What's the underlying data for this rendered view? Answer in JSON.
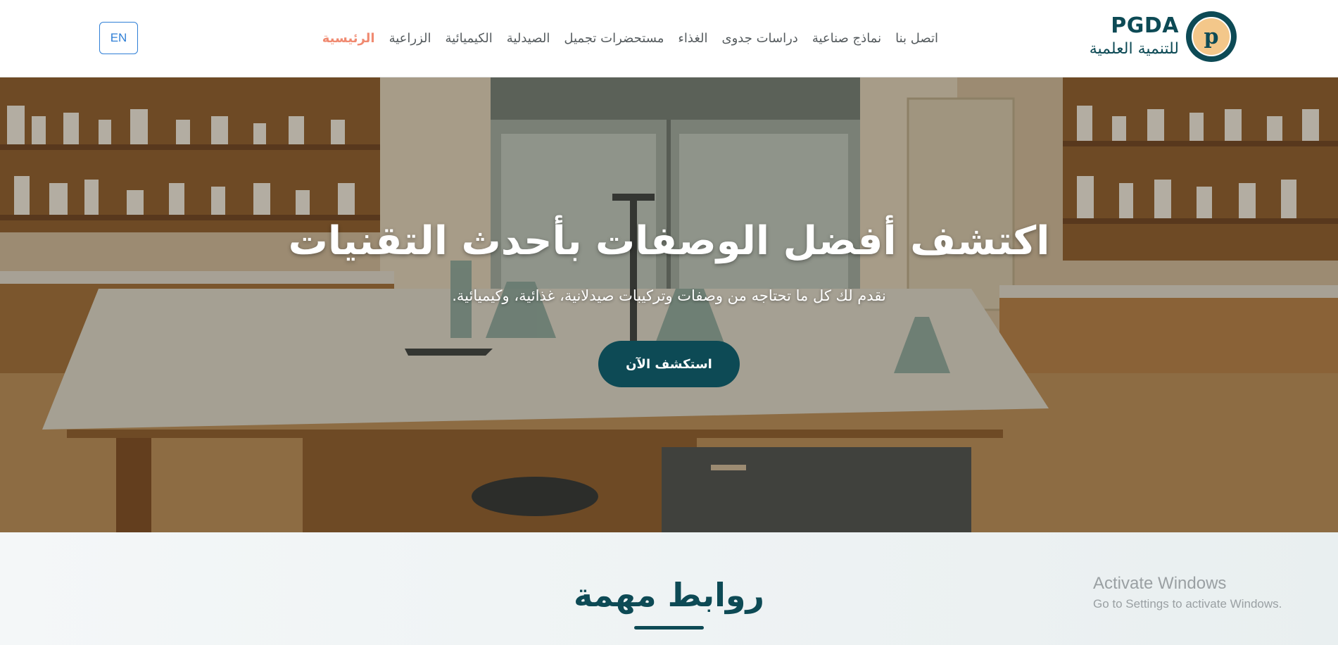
{
  "header": {
    "brand_name": "PGDA",
    "brand_subtitle": "للتنمية العلمية",
    "logo_letter": "p",
    "language_button": "EN",
    "nav": [
      {
        "label": "الرئيسية",
        "active": true
      },
      {
        "label": "الزراعية"
      },
      {
        "label": "الكيميائية"
      },
      {
        "label": "الصيدلية"
      },
      {
        "label": "مستحضرات تجميل"
      },
      {
        "label": "الغذاء"
      },
      {
        "label": "دراسات جدوى"
      },
      {
        "label": "نماذج صناعية"
      },
      {
        "label": "اتصل بنا"
      }
    ]
  },
  "hero": {
    "title": "اكتشف أفضل الوصفات بأحدث التقنيات",
    "subtitle": "نقدم لك كل ما تحتاجه من وصفات وتركيبات صيدلانية، غذائية، وكيميائية.",
    "cta_label": "استكشف الآن"
  },
  "links_section": {
    "title": "روابط مهمة"
  },
  "watermark": {
    "title": "Activate Windows",
    "subtitle": "Go to Settings to activate Windows."
  },
  "colors": {
    "primary": "#0d4a55",
    "active_nav": "#f08a71",
    "language_border": "#2f7fd6"
  }
}
